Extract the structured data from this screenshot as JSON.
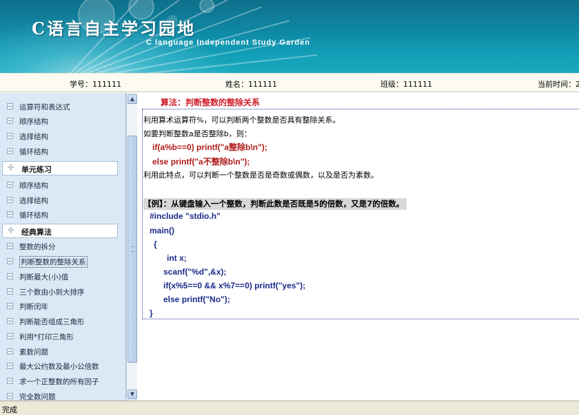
{
  "banner": {
    "title": "C语言自主学习园地",
    "subtitle": "C language Independent Study Garden"
  },
  "info": {
    "student_id_label": "学号：",
    "student_id": "111111",
    "name_label": "姓名：",
    "name": "111111",
    "class_label": "班级：",
    "class": "111111",
    "time_label": "当前时间：2"
  },
  "nav": {
    "top_items": [
      "运算符和表达式",
      "顺序结构",
      "选择结构",
      "循环结构"
    ],
    "section1": "单元练习",
    "section1_items": [
      "顺序结构",
      "选择结构",
      "循环结构"
    ],
    "section2": "经典算法",
    "section2_items": [
      "整数的拆分",
      "判断整数的整除关系",
      "判断最大(小)值",
      "三个数由小到大排序",
      "判断闰年",
      "判断能否组成三角形",
      "利用*打印三角形",
      "素数问题",
      "最大公约数及最小公倍数",
      "求一个正整数的所有因子",
      "完全数问题"
    ]
  },
  "content": {
    "title": "算法：判断整数的整除关系",
    "para1": "利用算术运算符%，可以判断两个整数是否具有整除关系。",
    "para2": "如要判断整数a是否整除b，则：",
    "code1": "if(a%b==0) printf(\"a整除b\\n\");",
    "code2": "else printf(\"a不整除b\\n\");",
    "para3": "利用此特点，可以判断一个整数是否是奇数或偶数，以及是否为素数。",
    "example": "【例】：从键盘输入一个整数，判断此数是否既是5的倍数，又是7的倍数。",
    "lines": [
      "#include \"stdio.h\"",
      "main()",
      "{",
      "int x;",
      "scanf(\"%d\",&x);",
      "if(x%5==0 && x%7==0) printf(\"yes\");",
      "else printf(\"No\");",
      "}"
    ]
  },
  "status": {
    "text": "完成"
  },
  "colors": {
    "banner": "#0f8aa6",
    "title_red": "#d0212b",
    "code_blue": "#1a2a8a",
    "nav_bg": "#dbe9f6"
  }
}
